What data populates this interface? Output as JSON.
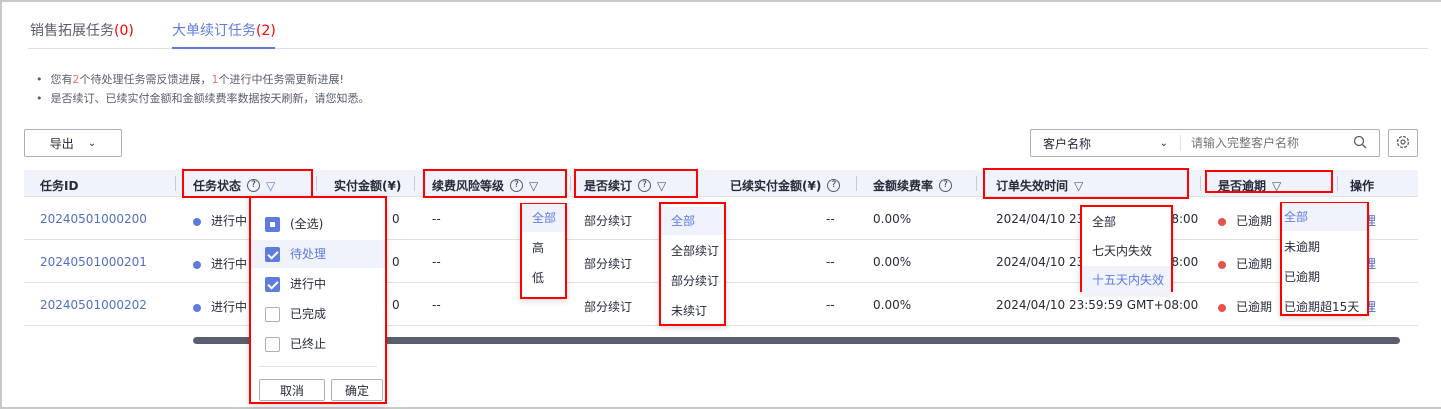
{
  "tabs": [
    {
      "label": "销售拓展任务",
      "count": "(0)"
    },
    {
      "label": "大单续订任务",
      "count": "(2)",
      "active": true
    }
  ],
  "notices": {
    "line1": {
      "a": "您有",
      "n1": "2",
      "b": "个待处理任务需反馈进展，",
      "n2": "1",
      "c": "个进行中任务需更新进展!"
    },
    "line2": "是否续订、已续实付金额和金额续费率数据按天刷新，请您知悉。"
  },
  "toolbar": {
    "export_label": "导出",
    "search_field": "客户名称",
    "search_placeholder": "请输入完整客户名称"
  },
  "columns": [
    "任务ID",
    "任务状态",
    "实付金额(¥)",
    "续费风险等级",
    "是否续订",
    "已续实付金额(¥)",
    "金额续费率",
    "订单失效时间",
    "是否逾期",
    "操作"
  ],
  "rows": [
    {
      "id": "20240501000200",
      "status": "进行中",
      "paid": "0",
      "risk": "--",
      "renew": "部分续订",
      "renewed_paid": "--",
      "rate": "0.00%",
      "expire": "2024/04/10 23:59:59 GMT+08:00",
      "overdue": "已逾期",
      "action": "处理"
    },
    {
      "id": "20240501000201",
      "status": "进行中",
      "paid": "0",
      "risk": "--",
      "renew": "部分续订",
      "renewed_paid": "--",
      "rate": "0.00%",
      "expire": "2024/04/10 23:59:59 GMT+08:00",
      "overdue": "已逾期",
      "action": "处理"
    },
    {
      "id": "20240501000202",
      "status": "进行中",
      "paid": "0",
      "risk": "--",
      "renew": "部分续订",
      "renewed_paid": "--",
      "rate": "0.00%",
      "expire": "2024/04/10 23:59:59 GMT+08:00",
      "overdue": "已逾期",
      "action": "处理"
    }
  ],
  "status_filter": {
    "options": [
      {
        "label": "(全选)",
        "state": "half"
      },
      {
        "label": "待处理",
        "state": "on"
      },
      {
        "label": "进行中",
        "state": "on"
      },
      {
        "label": "已完成",
        "state": "off"
      },
      {
        "label": "已终止",
        "state": "off"
      }
    ],
    "cancel": "取消",
    "ok": "确定"
  },
  "risk_filter": [
    "全部",
    "高",
    "低"
  ],
  "renew_filter": [
    "全部",
    "全部续订",
    "部分续订",
    "未续订"
  ],
  "expire_filter": [
    "全部",
    "七天内失效",
    "十五天内失效"
  ],
  "overdue_filter": [
    "全部",
    "未逾期",
    "已逾期",
    "已逾期超15天"
  ],
  "colors": {
    "accent": "#5e7ce0",
    "overdue": "#e5534b",
    "status_dot": "#5e7ce0",
    "highlight": "#ff0000"
  }
}
